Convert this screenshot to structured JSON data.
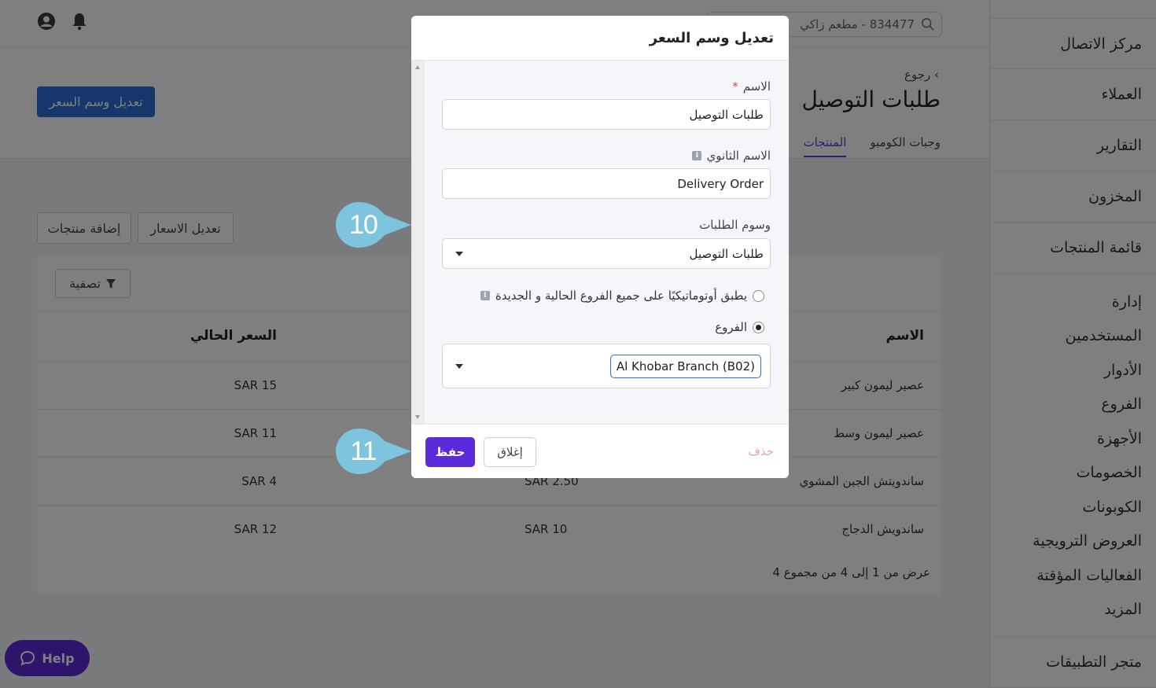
{
  "sidebar": {
    "top_items": [
      "مركز الاتصال",
      "العملاء",
      "التقارير",
      "المخزون",
      "قائمة المنتجات"
    ],
    "group_items": [
      "إدارة",
      "المستخدمين",
      "الأدوار",
      "الفروع",
      "الأجهزة",
      "الخصومات",
      "الكوبونات",
      "العروض الترويجية",
      "الفعاليات المؤقتة",
      "المزيد"
    ],
    "bottom_item": "متجر التطبيقات"
  },
  "topbar": {
    "search_text": "834477 - مطعم زاكي"
  },
  "header": {
    "back_label": "رجوع",
    "title": "طلبات التوصيل",
    "edit_button": "تعديل وسم السعر",
    "tabs": [
      "المنتجات",
      "وجبات الكومبو"
    ],
    "active_tab": "المنتجات"
  },
  "actions": {
    "edit_prices": "تعديل الاسعار",
    "add_products": "إضافة منتجات"
  },
  "table": {
    "filter_label": "تصفية",
    "columns": {
      "name": "الاسم",
      "current_price": "السعر الحالي"
    },
    "rows": [
      {
        "name": "عصير ليمون كبير",
        "mid": "",
        "current": "SAR 15"
      },
      {
        "name": "عصير ليمون وسط",
        "mid": "",
        "current": "SAR 11"
      },
      {
        "name": "ساندويتش الجبن المشوي",
        "mid": "SAR 2.50",
        "current": "SAR 4"
      },
      {
        "name": "ساندويش الدجاج",
        "mid": "SAR 10",
        "current": "SAR 12"
      }
    ],
    "pager": "عرض من 1 إلى 4 من مجموع 4"
  },
  "help_label": "Help",
  "modal": {
    "title": "تعديل وسم السعر",
    "name_label": "الاسم",
    "name_required": "*",
    "name_value": "طلبات التوصيل",
    "secondary_name_label": "الاسم الثانوي",
    "secondary_name_value": "Delivery Order",
    "order_tags_label": "وسوم الطلبات",
    "order_tags_value": "طلبات التوصيل",
    "auto_apply_label": "يطبق أوتوماتيكيًا على جميع الفروع الحالية و الجديدة",
    "branches_label": "الفروع",
    "branch_chip": "Al Khobar Branch (B02)",
    "save_label": "حفظ",
    "close_label": "إغلاق",
    "delete_label": "حذف"
  },
  "callouts": {
    "first": "10",
    "second": "11",
    "color": "#7ec4dc"
  },
  "colors": {
    "primary": "#5b2bd9",
    "blue": "#2c6fd6",
    "danger_text": "#f0a5a5"
  }
}
